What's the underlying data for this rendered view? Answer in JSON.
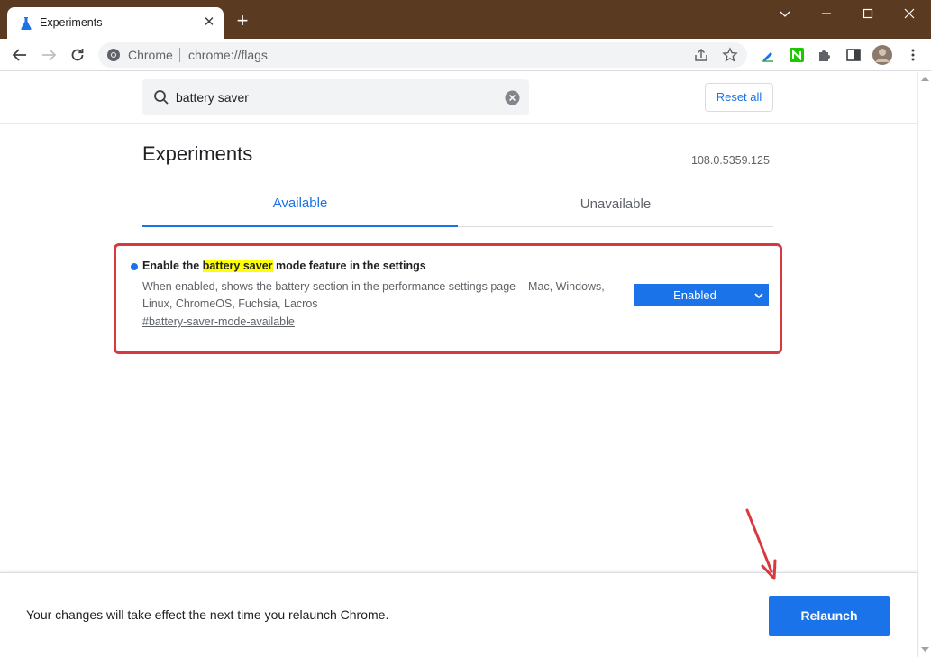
{
  "browser": {
    "tab_title": "Experiments",
    "new_tab_symbol": "+",
    "tab_close_symbol": "✕",
    "omnibox_site_label": "Chrome",
    "omnibox_url": "chrome://flags"
  },
  "page": {
    "search_value": "battery saver",
    "reset_label": "Reset all",
    "title": "Experiments",
    "version": "108.0.5359.125",
    "tabs": [
      {
        "label": "Available"
      },
      {
        "label": "Unavailable"
      }
    ],
    "flag": {
      "title_prefix": "Enable the ",
      "title_highlight": "battery saver",
      "title_suffix": " mode feature in the settings",
      "description": "When enabled, shows the battery section in the performance settings page – Mac, Windows, Linux, ChromeOS, Fuchsia, Lacros",
      "link": "#battery-saver-mode-available",
      "selected_option": "Enabled"
    },
    "bottom_message": "Your changes will take effect the next time you relaunch Chrome.",
    "relaunch_label": "Relaunch"
  },
  "colors": {
    "titlebar": "#5b3a22",
    "accent": "#1a73e8",
    "highlight_border": "#d9383f",
    "search_highlight": "#ffff00"
  }
}
